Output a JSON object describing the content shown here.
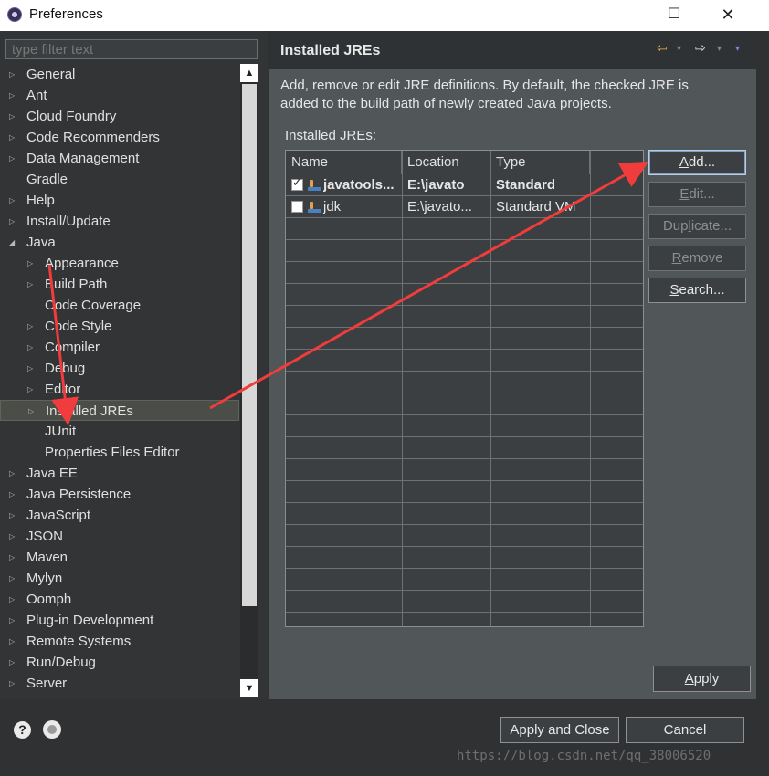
{
  "window": {
    "title": "Preferences",
    "minimize": "—",
    "maximize": "☐",
    "close": "✕"
  },
  "filter": {
    "placeholder": "type filter text"
  },
  "tree": [
    {
      "label": "General",
      "level": 0,
      "arrow": "▷"
    },
    {
      "label": "Ant",
      "level": 0,
      "arrow": "▷"
    },
    {
      "label": "Cloud Foundry",
      "level": 0,
      "arrow": "▷"
    },
    {
      "label": "Code Recommenders",
      "level": 0,
      "arrow": "▷"
    },
    {
      "label": "Data Management",
      "level": 0,
      "arrow": "▷"
    },
    {
      "label": "Gradle",
      "level": 0,
      "arrow": ""
    },
    {
      "label": "Help",
      "level": 0,
      "arrow": "▷"
    },
    {
      "label": "Install/Update",
      "level": 0,
      "arrow": "▷"
    },
    {
      "label": "Java",
      "level": 0,
      "arrow": "◢"
    },
    {
      "label": "Appearance",
      "level": 1,
      "arrow": "▷"
    },
    {
      "label": "Build Path",
      "level": 1,
      "arrow": "▷"
    },
    {
      "label": "Code Coverage",
      "level": 1,
      "arrow": ""
    },
    {
      "label": "Code Style",
      "level": 1,
      "arrow": "▷"
    },
    {
      "label": "Compiler",
      "level": 1,
      "arrow": "▷"
    },
    {
      "label": "Debug",
      "level": 1,
      "arrow": "▷"
    },
    {
      "label": "Editor",
      "level": 1,
      "arrow": "▷"
    },
    {
      "label": "Installed JREs",
      "level": 1,
      "arrow": "▷",
      "selected": true
    },
    {
      "label": "JUnit",
      "level": 1,
      "arrow": ""
    },
    {
      "label": "Properties Files Editor",
      "level": 1,
      "arrow": ""
    },
    {
      "label": "Java EE",
      "level": 0,
      "arrow": "▷"
    },
    {
      "label": "Java Persistence",
      "level": 0,
      "arrow": "▷"
    },
    {
      "label": "JavaScript",
      "level": 0,
      "arrow": "▷"
    },
    {
      "label": "JSON",
      "level": 0,
      "arrow": "▷"
    },
    {
      "label": "Maven",
      "level": 0,
      "arrow": "▷"
    },
    {
      "label": "Mylyn",
      "level": 0,
      "arrow": "▷"
    },
    {
      "label": "Oomph",
      "level": 0,
      "arrow": "▷"
    },
    {
      "label": "Plug-in Development",
      "level": 0,
      "arrow": "▷"
    },
    {
      "label": "Remote Systems",
      "level": 0,
      "arrow": "▷"
    },
    {
      "label": "Run/Debug",
      "level": 0,
      "arrow": "▷"
    },
    {
      "label": "Server",
      "level": 0,
      "arrow": "▷"
    }
  ],
  "page": {
    "title": "Installed JREs",
    "description_line1": "Add, remove or edit JRE definitions. By default, the checked JRE is",
    "description_line2": "added to the build path of newly created Java projects.",
    "table_label": "Installed JREs:",
    "nav_back": "⇦",
    "nav_forward": "⇨",
    "nav_menu": "▾"
  },
  "table": {
    "columns": [
      "Name",
      "Location",
      "Type"
    ],
    "rows": [
      {
        "checked": true,
        "name": "javatools...",
        "location": "E:\\javato",
        "type": "Standard",
        "bold": true
      },
      {
        "checked": false,
        "name": "jdk",
        "location": "E:\\javato...",
        "type": "Standard VM",
        "bold": false
      }
    ]
  },
  "buttons": {
    "add": {
      "pre": "",
      "key": "A",
      "post": "dd..."
    },
    "edit": {
      "pre": "",
      "key": "E",
      "post": "dit..."
    },
    "duplicate": {
      "pre": "Dup",
      "key": "l",
      "post": "icate..."
    },
    "remove": {
      "pre": "",
      "key": "R",
      "post": "emove"
    },
    "search": {
      "pre": "",
      "key": "S",
      "post": "earch..."
    },
    "apply": {
      "pre": "",
      "key": "A",
      "post": "pply"
    },
    "apply_close": "Apply and Close",
    "cancel": "Cancel"
  },
  "watermark": "https://blog.csdn.net/qq_38006520",
  "colors": {
    "arrow": "#f03c3c",
    "selected_bg": "#4b4d48"
  }
}
